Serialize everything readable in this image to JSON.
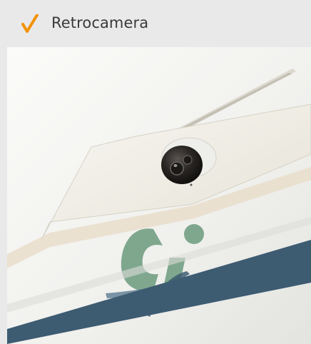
{
  "feature": {
    "checked": true,
    "label": "Retrocamera"
  },
  "photo": {
    "logo_text": "ci",
    "description_icon": "rear-camera-photo"
  },
  "colors": {
    "background": "#e9e9e9",
    "check_accent": "#f39200",
    "label_text": "#3a3a3a",
    "logo_green": "#6b9a7c",
    "logo_blue": "#35556d",
    "stripe_blue": "#3d5b71"
  }
}
